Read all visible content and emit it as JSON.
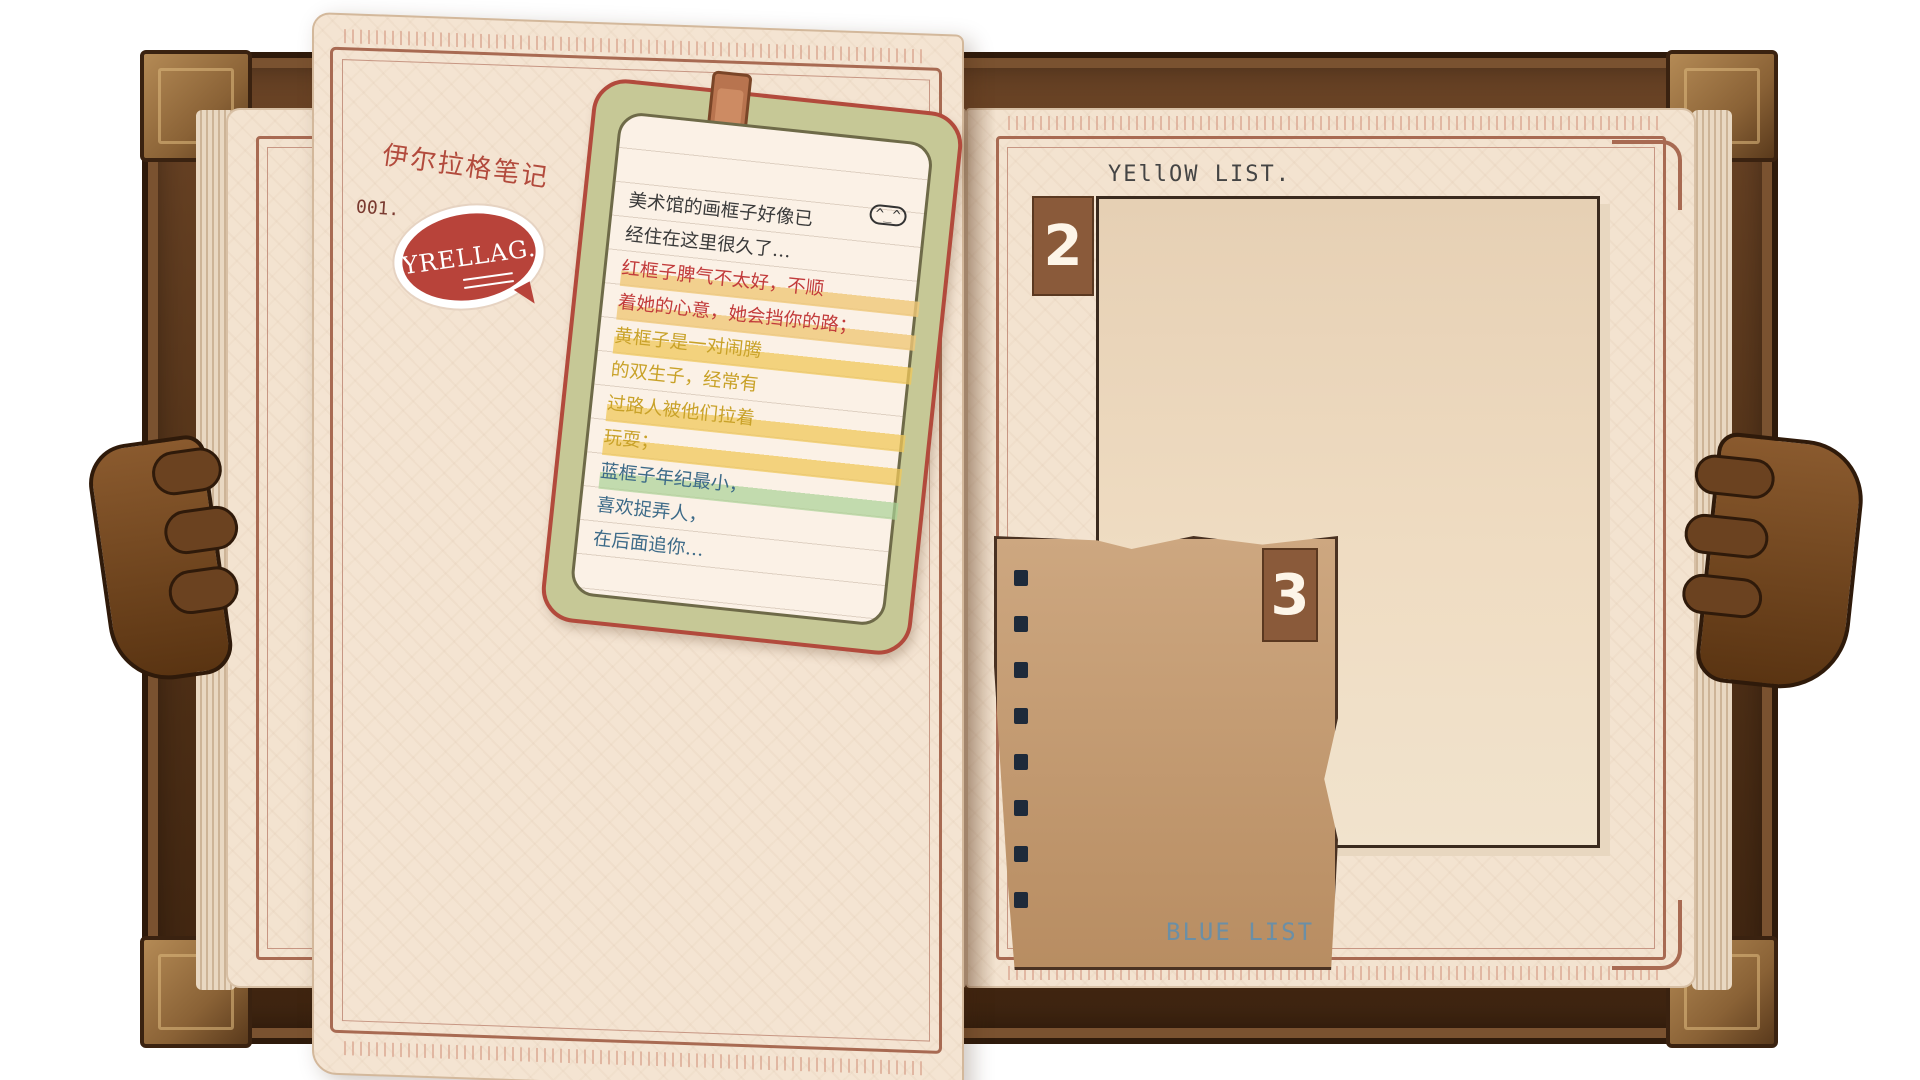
{
  "notebook": {
    "title": "伊尔拉格笔记",
    "page_number": "001.",
    "speech_bubble": "YRELLAG."
  },
  "note": {
    "face": "^_^",
    "lines": [
      {
        "text": "美术馆的画框子好像已",
        "color": "#3a3a3a",
        "style": "plain"
      },
      {
        "text": "经住在这里很久了…",
        "color": "#3a3a3a",
        "style": "plain"
      },
      {
        "text": "红框子脾气不太好，不顺",
        "color": "#c23b3b",
        "style": "red"
      },
      {
        "text": "着她的心意，她会挡你的路；",
        "color": "#c23b3b",
        "style": "red"
      },
      {
        "text": "黄框子是一对闹腾",
        "color": "#c9a229",
        "style": "yellow"
      },
      {
        "text": "的双生子，经常有",
        "color": "#c9a229",
        "style": "plain"
      },
      {
        "text": "过路人被他们拉着",
        "color": "#c9a229",
        "style": "yellow"
      },
      {
        "text": "玩耍；",
        "color": "#c9a229",
        "style": "yellow"
      },
      {
        "text": "蓝框子年纪最小，",
        "color": "#3c6a88",
        "style": "blue"
      },
      {
        "text": "喜欢捉弄人，",
        "color": "#3c6a88",
        "style": "plain"
      },
      {
        "text": "在后面追你…",
        "color": "#3c6a88",
        "style": "plain"
      }
    ]
  },
  "right_page": {
    "yellow_list_title": "YEllOW LIST.",
    "yellow_number": "2",
    "blue_number": "3",
    "blue_list_title": "BLUE LIST"
  },
  "colors": {
    "accent_red": "#b8433a",
    "frame_brown": "#a86a52",
    "tag_brown": "#8a5a3a",
    "blue_text": "#6b8fa6"
  }
}
